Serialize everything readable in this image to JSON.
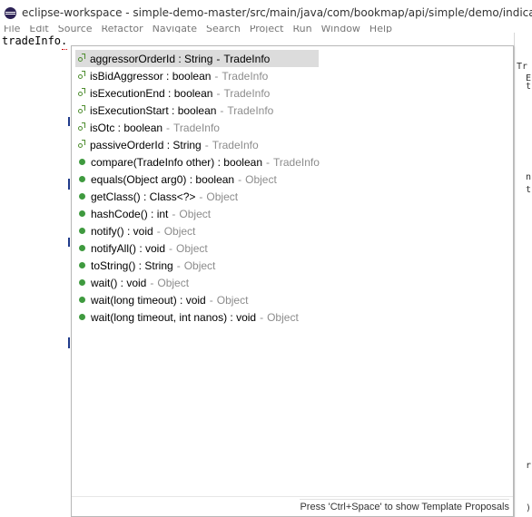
{
  "window": {
    "title": "eclipse-workspace - simple-demo-master/src/main/java/com/bookmap/api/simple/demo/indicators/Quo"
  },
  "menubar": [
    "File",
    "Edit",
    "Source",
    "Refactor",
    "Navigate",
    "Search",
    "Project",
    "Run",
    "Window",
    "Help"
  ],
  "editor": {
    "code_line": "tradeInfo."
  },
  "right_panel": {
    "fragments": [
      "Tr",
      "E",
      "t",
      "n",
      "t",
      "r",
      ")"
    ]
  },
  "proposals": [
    {
      "kind": "field-icon",
      "name": "aggressorOrderId : String",
      "sep": "-",
      "qual": "TradeInfo",
      "selected": true
    },
    {
      "kind": "field-icon",
      "name": "isBidAggressor : boolean",
      "sep": "-",
      "qual": "TradeInfo",
      "selected": false
    },
    {
      "kind": "field-icon",
      "name": "isExecutionEnd : boolean",
      "sep": "-",
      "qual": "TradeInfo",
      "selected": false
    },
    {
      "kind": "field-icon",
      "name": "isExecutionStart : boolean",
      "sep": "-",
      "qual": "TradeInfo",
      "selected": false
    },
    {
      "kind": "field-icon",
      "name": "isOtc : boolean",
      "sep": "-",
      "qual": "TradeInfo",
      "selected": false
    },
    {
      "kind": "field-icon",
      "name": "passiveOrderId : String",
      "sep": "-",
      "qual": "TradeInfo",
      "selected": false
    },
    {
      "kind": "method-icon",
      "name": "compare(TradeInfo other) : boolean",
      "sep": "-",
      "qual": "TradeInfo",
      "selected": false
    },
    {
      "kind": "method-icon",
      "name": "equals(Object arg0) : boolean",
      "sep": "-",
      "qual": "Object",
      "selected": false
    },
    {
      "kind": "method-icon",
      "name": "getClass() : Class<?>",
      "sep": "-",
      "qual": "Object",
      "selected": false
    },
    {
      "kind": "method-icon",
      "name": "hashCode() : int",
      "sep": "-",
      "qual": "Object",
      "selected": false
    },
    {
      "kind": "method-icon",
      "name": "notify() : void",
      "sep": "-",
      "qual": "Object",
      "selected": false
    },
    {
      "kind": "method-icon",
      "name": "notifyAll() : void",
      "sep": "-",
      "qual": "Object",
      "selected": false
    },
    {
      "kind": "method-icon",
      "name": "toString() : String",
      "sep": "-",
      "qual": "Object",
      "selected": false
    },
    {
      "kind": "method-icon",
      "name": "wait() : void",
      "sep": "-",
      "qual": "Object",
      "selected": false
    },
    {
      "kind": "method-icon",
      "name": "wait(long timeout) : void",
      "sep": "-",
      "qual": "Object",
      "selected": false
    },
    {
      "kind": "method-icon",
      "name": "wait(long timeout, int nanos) : void",
      "sep": "-",
      "qual": "Object",
      "selected": false
    }
  ],
  "status": {
    "hint": "Press 'Ctrl+Space' to show Template Proposals"
  },
  "colors": {
    "selection": "#dcdcdc",
    "qualifier": "#8c8c8c",
    "method_icon": "#3f9a3f",
    "field_icon": "#4e8d2f"
  }
}
